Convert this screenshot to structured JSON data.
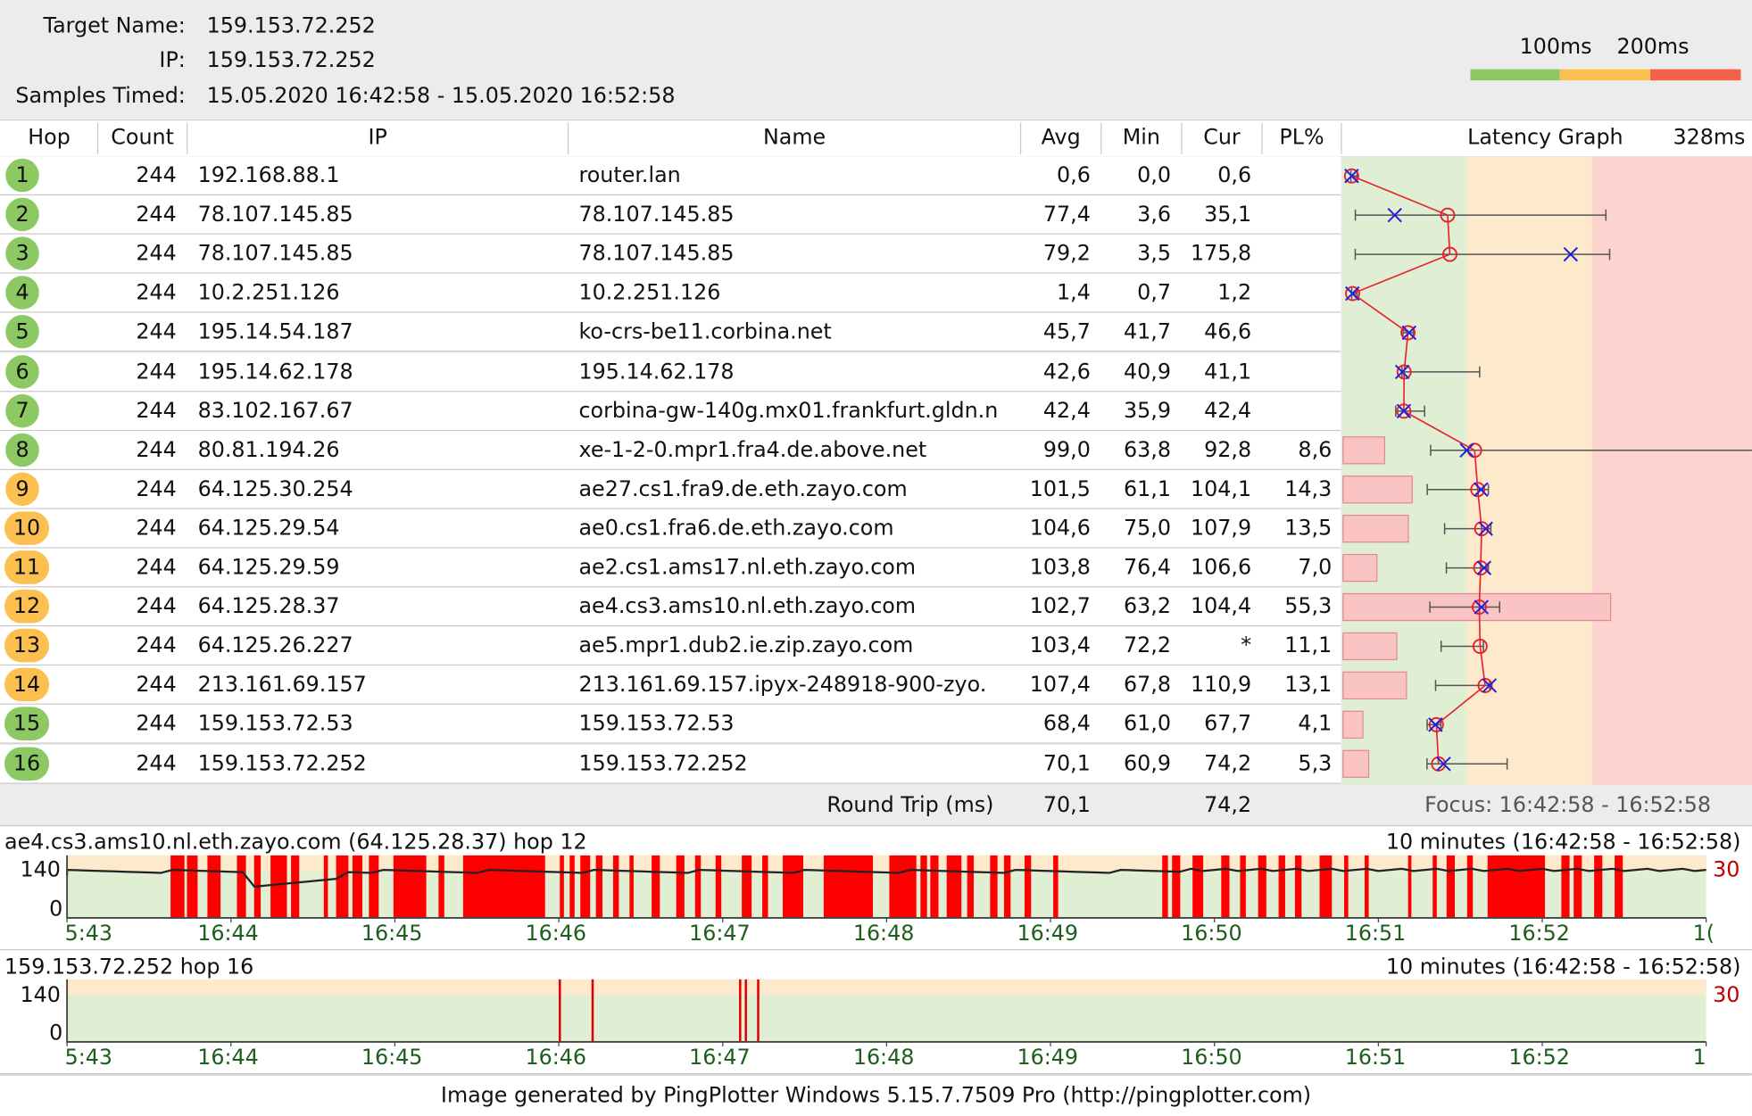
{
  "header": {
    "target_name_label": "Target Name:",
    "target_name_value": "159.153.72.252",
    "ip_label": "IP:",
    "ip_value": "159.153.72.252",
    "samples_label": "Samples Timed:",
    "samples_value": "15.05.2020 16:42:58 - 15.05.2020 16:52:58",
    "scale_100": "100ms",
    "scale_200": "200ms",
    "scale_colors": [
      "#8cc963",
      "#fbc04f",
      "#f4604a"
    ]
  },
  "columns": {
    "hop": "Hop",
    "count": "Count",
    "ip": "IP",
    "name": "Name",
    "avg": "Avg",
    "min": "Min",
    "cur": "Cur",
    "pl": "PL%",
    "graph": "Latency Graph",
    "graph_max": "328ms"
  },
  "rows": [
    {
      "hop": "1",
      "count": "244",
      "ip": "192.168.88.1",
      "name": "router.lan",
      "avg": "0,6",
      "min": "0,0",
      "cur": "0,6",
      "pl": "",
      "status": "good"
    },
    {
      "hop": "2",
      "count": "244",
      "ip": "78.107.145.85",
      "name": "78.107.145.85",
      "avg": "77,4",
      "min": "3,6",
      "cur": "35,1",
      "pl": "",
      "status": "good"
    },
    {
      "hop": "3",
      "count": "244",
      "ip": "78.107.145.85",
      "name": "78.107.145.85",
      "avg": "79,2",
      "min": "3,5",
      "cur": "175,8",
      "pl": "",
      "status": "good"
    },
    {
      "hop": "4",
      "count": "244",
      "ip": "10.2.251.126",
      "name": "10.2.251.126",
      "avg": "1,4",
      "min": "0,7",
      "cur": "1,2",
      "pl": "",
      "status": "good"
    },
    {
      "hop": "5",
      "count": "244",
      "ip": "195.14.54.187",
      "name": "ko-crs-be11.corbina.net",
      "avg": "45,7",
      "min": "41,7",
      "cur": "46,6",
      "pl": "",
      "status": "good"
    },
    {
      "hop": "6",
      "count": "244",
      "ip": "195.14.62.178",
      "name": "195.14.62.178",
      "avg": "42,6",
      "min": "40,9",
      "cur": "41,1",
      "pl": "",
      "status": "good"
    },
    {
      "hop": "7",
      "count": "244",
      "ip": "83.102.167.67",
      "name": "corbina-gw-140g.mx01.frankfurt.gldn.n",
      "avg": "42,4",
      "min": "35,9",
      "cur": "42,4",
      "pl": "",
      "status": "good"
    },
    {
      "hop": "8",
      "count": "244",
      "ip": "80.81.194.26",
      "name": "xe-1-2-0.mpr1.fra4.de.above.net",
      "avg": "99,0",
      "min": "63,8",
      "cur": "92,8",
      "pl": "8,6",
      "status": "good"
    },
    {
      "hop": "9",
      "count": "244",
      "ip": "64.125.30.254",
      "name": "ae27.cs1.fra9.de.eth.zayo.com",
      "avg": "101,5",
      "min": "61,1",
      "cur": "104,1",
      "pl": "14,3",
      "status": "warn"
    },
    {
      "hop": "10",
      "count": "244",
      "ip": "64.125.29.54",
      "name": "ae0.cs1.fra6.de.eth.zayo.com",
      "avg": "104,6",
      "min": "75,0",
      "cur": "107,9",
      "pl": "13,5",
      "status": "warn"
    },
    {
      "hop": "11",
      "count": "244",
      "ip": "64.125.29.59",
      "name": "ae2.cs1.ams17.nl.eth.zayo.com",
      "avg": "103,8",
      "min": "76,4",
      "cur": "106,6",
      "pl": "7,0",
      "status": "warn"
    },
    {
      "hop": "12",
      "count": "244",
      "ip": "64.125.28.37",
      "name": "ae4.cs3.ams10.nl.eth.zayo.com",
      "avg": "102,7",
      "min": "63,2",
      "cur": "104,4",
      "pl": "55,3",
      "status": "warn"
    },
    {
      "hop": "13",
      "count": "244",
      "ip": "64.125.26.227",
      "name": "ae5.mpr1.dub2.ie.zip.zayo.com",
      "avg": "103,4",
      "min": "72,2",
      "cur": "*",
      "pl": "11,1",
      "status": "warn"
    },
    {
      "hop": "14",
      "count": "244",
      "ip": "213.161.69.157",
      "name": "213.161.69.157.ipyx-248918-900-zyo.",
      "avg": "107,4",
      "min": "67,8",
      "cur": "110,9",
      "pl": "13,1",
      "status": "warn"
    },
    {
      "hop": "15",
      "count": "244",
      "ip": "159.153.72.53",
      "name": "159.153.72.53",
      "avg": "68,4",
      "min": "61,0",
      "cur": "67,7",
      "pl": "4,1",
      "status": "good"
    },
    {
      "hop": "16",
      "count": "244",
      "ip": "159.153.72.252",
      "name": "159.153.72.252",
      "avg": "70,1",
      "min": "60,9",
      "cur": "74,2",
      "pl": "5,3",
      "status": "good"
    }
  ],
  "latency_graph": {
    "max_ms": 328,
    "zones": [
      {
        "to_ms": 100,
        "color": "#e0efd4"
      },
      {
        "to_ms": 200,
        "color": "#fde9cc"
      },
      {
        "to_ms": 328,
        "color": "#fdd3d0"
      }
    ],
    "hops": [
      {
        "avg": 0.6,
        "cur": 0.6,
        "min": 0.0,
        "max": 5,
        "pl": 0
      },
      {
        "avg": 77.4,
        "cur": 35.1,
        "min": 3.6,
        "max": 204,
        "pl": 0
      },
      {
        "avg": 79.2,
        "cur": 175.8,
        "min": 3.5,
        "max": 207,
        "pl": 0
      },
      {
        "avg": 1.4,
        "cur": 1.2,
        "min": 0.7,
        "max": 5,
        "pl": 0
      },
      {
        "avg": 45.7,
        "cur": 46.6,
        "min": 41.7,
        "max": 50,
        "pl": 0
      },
      {
        "avg": 42.6,
        "cur": 41.1,
        "min": 40.9,
        "max": 103,
        "pl": 0
      },
      {
        "avg": 42.4,
        "cur": 42.4,
        "min": 35.9,
        "max": 59,
        "pl": 0
      },
      {
        "avg": 99.0,
        "cur": 92.8,
        "min": 63.8,
        "max": 322,
        "pl": 8.6
      },
      {
        "avg": 101.5,
        "cur": 104.1,
        "min": 61.1,
        "max": 110,
        "pl": 14.3
      },
      {
        "avg": 104.6,
        "cur": 107.9,
        "min": 75.0,
        "max": 112,
        "pl": 13.5
      },
      {
        "avg": 103.8,
        "cur": 106.6,
        "min": 76.4,
        "max": 110,
        "pl": 7.0
      },
      {
        "avg": 102.7,
        "cur": 104.4,
        "min": 63.2,
        "max": 119,
        "pl": 55.3
      },
      {
        "avg": 103.4,
        "cur": null,
        "min": 72.2,
        "max": 106,
        "pl": 11.1
      },
      {
        "avg": 107.4,
        "cur": 110.9,
        "min": 67.8,
        "max": 111,
        "pl": 13.1
      },
      {
        "avg": 68.4,
        "cur": 67.7,
        "min": 61.0,
        "max": 72,
        "pl": 4.1
      },
      {
        "avg": 70.1,
        "cur": 74.2,
        "min": 60.9,
        "max": 125,
        "pl": 5.3
      }
    ]
  },
  "summary": {
    "round_trip_label": "Round Trip (ms)",
    "avg": "70,1",
    "cur": "74,2",
    "focus": "Focus: 16:42:58 - 16:52:58"
  },
  "timeline1": {
    "title": "ae4.cs3.ams10.nl.eth.zayo.com (64.125.28.37) hop 12",
    "range": "10 minutes (16:42:58 - 16:52:58)",
    "y_max": "140",
    "y_min": "0",
    "right_value": "30",
    "ticks": [
      "5:43",
      "16:44",
      "16:45",
      "16:46",
      "16:47",
      "16:48",
      "16:49",
      "16:50",
      "16:51",
      "16:52",
      "1("
    ],
    "loss_segments": [
      [
        16.843,
        16.86
      ],
      [
        16.863,
        16.876
      ],
      [
        16.888,
        16.904
      ],
      [
        16.924,
        16.935
      ],
      [
        16.945,
        16.953
      ],
      [
        16.965,
        16.985
      ],
      [
        16.99,
        17.0
      ],
      [
        17.03,
        17.035
      ],
      [
        17.045,
        17.06
      ],
      [
        17.065,
        17.077
      ],
      [
        17.085,
        17.097
      ],
      [
        17.115,
        17.155
      ],
      [
        17.17,
        17.177
      ],
      [
        17.2,
        17.3
      ],
      [
        17.318,
        17.323
      ],
      [
        17.33,
        17.336
      ],
      [
        17.343,
        17.355
      ],
      [
        17.362,
        17.37
      ],
      [
        17.383,
        17.39
      ],
      [
        17.403,
        17.408
      ],
      [
        17.43,
        17.44
      ],
      [
        17.46,
        17.47
      ],
      [
        17.483,
        17.49
      ],
      [
        17.508,
        17.515
      ],
      [
        17.54,
        17.552
      ],
      [
        17.565,
        17.572
      ],
      [
        17.59,
        17.615
      ],
      [
        17.64,
        17.7
      ],
      [
        17.72,
        17.753
      ],
      [
        17.758,
        17.766
      ],
      [
        17.77,
        17.78
      ],
      [
        17.79,
        17.808
      ],
      [
        17.815,
        17.823
      ],
      [
        17.843,
        17.852
      ],
      [
        17.86,
        17.868
      ],
      [
        17.885,
        17.893
      ],
      [
        17.92,
        17.926
      ],
      [
        18.053,
        18.06
      ],
      [
        18.065,
        18.075
      ],
      [
        18.09,
        18.103
      ],
      [
        18.125,
        18.135
      ],
      [
        18.148,
        18.155
      ],
      [
        18.17,
        18.18
      ],
      [
        18.195,
        18.203
      ],
      [
        18.215,
        18.223
      ],
      [
        18.245,
        18.26
      ],
      [
        18.275,
        18.28
      ],
      [
        18.3,
        18.305
      ],
      [
        18.353,
        18.357
      ],
      [
        18.383,
        18.388
      ],
      [
        18.4,
        18.41
      ],
      [
        18.425,
        18.432
      ],
      [
        18.45,
        18.52
      ],
      [
        18.54,
        18.55
      ],
      [
        18.555,
        18.565
      ],
      [
        18.58,
        18.59
      ],
      [
        18.605,
        18.615
      ]
    ]
  },
  "timeline2": {
    "title": "159.153.72.252 hop 16",
    "range": "10 minutes (16:42:58 - 16:52:58)",
    "y_max": "140",
    "y_min": "0",
    "right_value": "30",
    "ticks": [
      "5:43",
      "16:44",
      "16:45",
      "16:46",
      "16:47",
      "16:48",
      "16:49",
      "16:50",
      "16:51",
      "16:52",
      "1"
    ],
    "loss_events": [
      17.318,
      17.358,
      17.538,
      17.545,
      17.56
    ]
  },
  "footer": "Image generated by PingPlotter Windows 5.15.7.7509 Pro (http://pingplotter.com)"
}
